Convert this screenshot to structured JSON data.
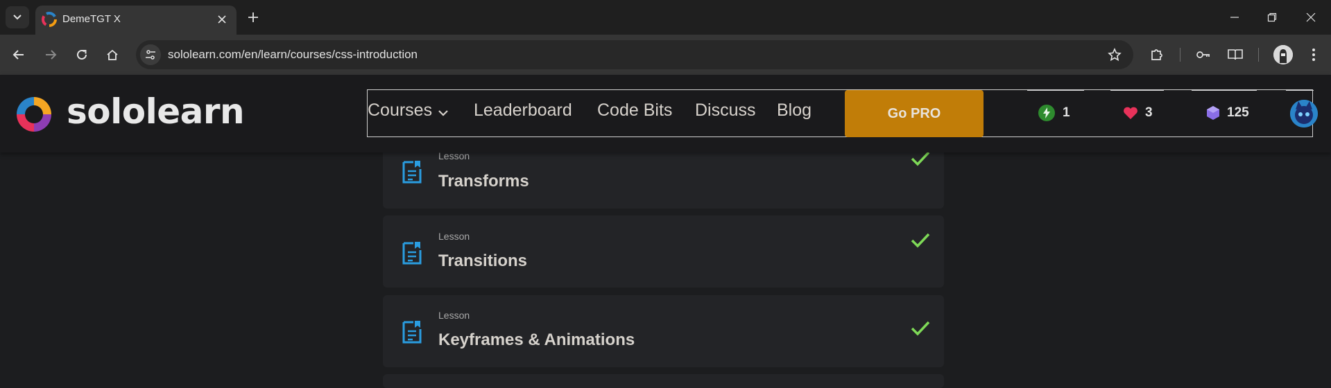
{
  "browser": {
    "tab": {
      "title": "DemeTGT X"
    },
    "url": "sololearn.com/en/learn/courses/css-introduction"
  },
  "header": {
    "logo_text": "sololearn",
    "nav": [
      {
        "label": "Courses"
      },
      {
        "label": "Leaderboard"
      },
      {
        "label": "Code Bits"
      },
      {
        "label": "Discuss"
      },
      {
        "label": "Blog"
      }
    ],
    "cta": "Go PRO",
    "stats": {
      "streak": "1",
      "hearts": "3",
      "bits": "125"
    },
    "colors": {
      "cta": "#c17d08",
      "streak": "#2e8b2e",
      "heart": "#e8325a",
      "bits": "#8a6ee6",
      "check": "#7ed957",
      "lesson_icon": "#2a9de0"
    }
  },
  "lessons": [
    {
      "kind": "Lesson",
      "title": "Transforms",
      "completed": true
    },
    {
      "kind": "Lesson",
      "title": "Transitions",
      "completed": true
    },
    {
      "kind": "Lesson",
      "title": "Keyframes & Animations",
      "completed": true
    }
  ]
}
